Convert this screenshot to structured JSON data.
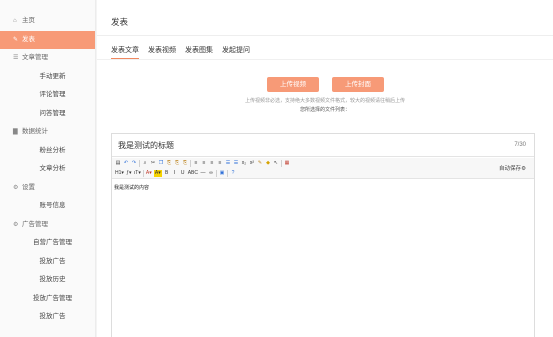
{
  "sidebar": {
    "items": [
      {
        "label": "主页",
        "icon": "home-icon",
        "glyph": "⌂",
        "kind": "group",
        "active": false,
        "name": "sidebar-item-home"
      },
      {
        "label": "发表",
        "icon": "edit-icon",
        "glyph": "✎",
        "kind": "group",
        "active": true,
        "name": "sidebar-item-publish"
      },
      {
        "label": "文章管理",
        "icon": "document-icon",
        "glyph": "☰",
        "kind": "group",
        "active": false,
        "name": "sidebar-item-article-mgmt"
      },
      {
        "label": "手动更新",
        "kind": "sub",
        "active": false,
        "name": "sidebar-item-manual-update"
      },
      {
        "label": "评论管理",
        "kind": "sub",
        "active": false,
        "name": "sidebar-item-comment-mgmt"
      },
      {
        "label": "问答管理",
        "kind": "sub",
        "active": false,
        "name": "sidebar-item-qa-mgmt"
      },
      {
        "label": "数据统计",
        "icon": "bar-chart-icon",
        "glyph": "▇",
        "kind": "group",
        "active": false,
        "name": "sidebar-item-statistics"
      },
      {
        "label": "粉丝分析",
        "kind": "sub",
        "active": false,
        "name": "sidebar-item-fans-analysis"
      },
      {
        "label": "文章分析",
        "kind": "sub",
        "active": false,
        "name": "sidebar-item-article-analysis"
      },
      {
        "label": "设置",
        "icon": "gear-icon",
        "glyph": "⚙",
        "kind": "group",
        "active": false,
        "name": "sidebar-item-settings"
      },
      {
        "label": "账号信息",
        "kind": "sub",
        "active": false,
        "name": "sidebar-item-account-info"
      },
      {
        "label": "广告管理",
        "icon": "gear-icon",
        "glyph": "⚙",
        "kind": "group",
        "active": false,
        "name": "sidebar-item-ad-mgmt"
      },
      {
        "label": "自营广告管理",
        "kind": "sub",
        "active": false,
        "name": "sidebar-item-own-ad-mgmt"
      },
      {
        "label": "投放广告",
        "kind": "sub",
        "active": false,
        "name": "sidebar-item-place-ad"
      },
      {
        "label": "投放历史",
        "kind": "sub",
        "active": false,
        "name": "sidebar-item-place-history"
      },
      {
        "label": "投放广告管理",
        "kind": "sub",
        "active": false,
        "name": "sidebar-item-placed-ad-mgmt"
      },
      {
        "label": "投放广告",
        "kind": "sub",
        "active": false,
        "name": "sidebar-item-place-ad-2"
      }
    ]
  },
  "header": {
    "title": "发表"
  },
  "tabs": [
    {
      "label": "发表文章",
      "active": true
    },
    {
      "label": "发表视频",
      "active": false
    },
    {
      "label": "发表图集",
      "active": false
    },
    {
      "label": "发起提问",
      "active": false
    }
  ],
  "upload": {
    "video_button": "上传视频",
    "cover_button": "上传封面",
    "hint": "上传视频非必选，支持绝大多数视频文件格式，较大的视频请往稍后上传",
    "file_list_label": "您所选择的文件列表："
  },
  "editor": {
    "title_value": "我是测试的标题",
    "title_count": "7/30",
    "autosave_label": "自动保存",
    "content": "我是测试的内容",
    "toolbar_row1": [
      {
        "name": "source-code-icon",
        "glyph": "▤"
      },
      {
        "name": "undo-icon",
        "glyph": "↶",
        "color": "#2d6fd8"
      },
      {
        "name": "redo-icon",
        "glyph": "↷",
        "color": "#2d6fd8"
      },
      {
        "sep": true
      },
      {
        "name": "find-icon",
        "glyph": "⌕"
      },
      {
        "name": "cut-icon",
        "glyph": "✂"
      },
      {
        "name": "copy-icon",
        "glyph": "❐",
        "color": "#2d6fd8"
      },
      {
        "name": "paste-icon",
        "glyph": "⎘",
        "color": "#c08a2a"
      },
      {
        "name": "paste-text-icon",
        "glyph": "⎘",
        "color": "#c08a2a"
      },
      {
        "name": "paste-word-icon",
        "glyph": "⎘",
        "color": "#c08a2a"
      },
      {
        "sep": true
      },
      {
        "name": "align-left-icon",
        "glyph": "≡"
      },
      {
        "name": "align-center-icon",
        "glyph": "≡"
      },
      {
        "name": "align-right-icon",
        "glyph": "≡"
      },
      {
        "name": "align-justify-icon",
        "glyph": "≡"
      },
      {
        "name": "ordered-list-icon",
        "glyph": "☰",
        "color": "#2d6fd8"
      },
      {
        "name": "unordered-list-icon",
        "glyph": "☰",
        "color": "#2d6fd8"
      },
      {
        "name": "subscript-icon",
        "glyph": "x₂"
      },
      {
        "name": "superscript-icon",
        "glyph": "x²"
      },
      {
        "name": "brush-icon",
        "glyph": "✎",
        "color": "#c08a2a"
      },
      {
        "name": "eraser-icon",
        "glyph": "◆",
        "color": "#d6a300"
      },
      {
        "name": "select-all-icon",
        "glyph": "↖"
      },
      {
        "sep": true
      },
      {
        "name": "table-icon",
        "glyph": "▦",
        "color": "#c0392b"
      }
    ],
    "toolbar_row2": [
      {
        "name": "heading-icon",
        "glyph": "H1▾"
      },
      {
        "name": "font-family-icon",
        "glyph": "ƒ▾"
      },
      {
        "name": "font-size-icon",
        "glyph": "ıT▾"
      },
      {
        "sep": true
      },
      {
        "name": "font-color-icon",
        "glyph": "A▾",
        "color": "#c0392b"
      },
      {
        "name": "highlight-icon",
        "glyph": "A▾",
        "bg": "#f7d300"
      },
      {
        "name": "bold-icon",
        "glyph": "B"
      },
      {
        "name": "italic-icon",
        "glyph": "I"
      },
      {
        "name": "underline-icon",
        "glyph": "U"
      },
      {
        "name": "strikethrough-icon",
        "glyph": "ABC"
      },
      {
        "name": "horizontal-rule-icon",
        "glyph": "―"
      },
      {
        "name": "link-icon",
        "glyph": "∞"
      },
      {
        "sep": true
      },
      {
        "name": "image-icon",
        "glyph": "▣",
        "color": "#2d6fd8"
      },
      {
        "sep": true
      },
      {
        "name": "help-icon",
        "glyph": "?",
        "color": "#2d6fd8"
      }
    ]
  }
}
